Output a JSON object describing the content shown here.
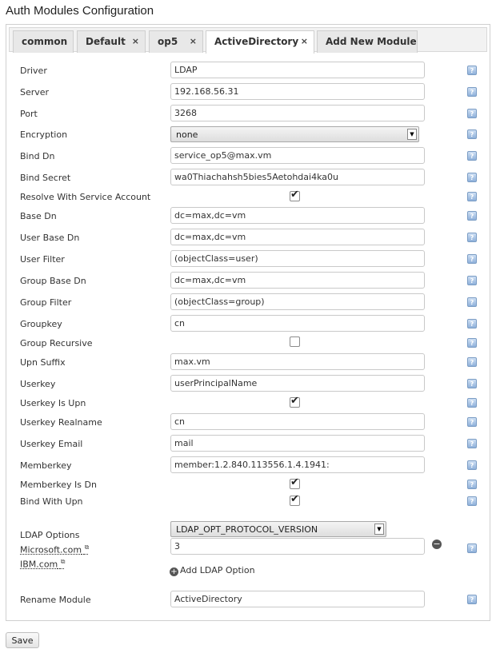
{
  "page": {
    "title": "Auth Modules Configuration"
  },
  "tabs": [
    {
      "label": "common",
      "closable": false,
      "active": false
    },
    {
      "label": "Default",
      "closable": true,
      "active": false
    },
    {
      "label": "op5",
      "closable": true,
      "active": false
    },
    {
      "label": "ActiveDirectory",
      "closable": true,
      "active": true
    },
    {
      "label": "Add New Module",
      "closable": false,
      "active": false
    }
  ],
  "close_glyph": "×",
  "help_glyph": "?",
  "form": {
    "driver": {
      "label": "Driver",
      "value": "LDAP"
    },
    "server": {
      "label": "Server",
      "value": "192.168.56.31"
    },
    "port": {
      "label": "Port",
      "value": "3268"
    },
    "encryption": {
      "label": "Encryption",
      "value": "none"
    },
    "bind_dn": {
      "label": "Bind Dn",
      "value": "service_op5@max.vm"
    },
    "bind_secret": {
      "label": "Bind Secret",
      "value": "wa0Thiachahsh5bies5Aetohdai4ka0u"
    },
    "resolve_with_service_account": {
      "label": "Resolve With Service Account",
      "checked": true
    },
    "base_dn": {
      "label": "Base Dn",
      "value": "dc=max,dc=vm"
    },
    "user_base_dn": {
      "label": "User Base Dn",
      "value": "dc=max,dc=vm"
    },
    "user_filter": {
      "label": "User Filter",
      "value": "(objectClass=user)"
    },
    "group_base_dn": {
      "label": "Group Base Dn",
      "value": "dc=max,dc=vm"
    },
    "group_filter": {
      "label": "Group Filter",
      "value": "(objectClass=group)"
    },
    "groupkey": {
      "label": "Groupkey",
      "value": "cn"
    },
    "group_recursive": {
      "label": "Group Recursive",
      "checked": false
    },
    "upn_suffix": {
      "label": "Upn Suffix",
      "value": "max.vm"
    },
    "userkey": {
      "label": "Userkey",
      "value": "userPrincipalName"
    },
    "userkey_is_upn": {
      "label": "Userkey Is Upn",
      "checked": true
    },
    "userkey_realname": {
      "label": "Userkey Realname",
      "value": "cn"
    },
    "userkey_email": {
      "label": "Userkey Email",
      "value": "mail"
    },
    "memberkey": {
      "label": "Memberkey",
      "value": "member:1.2.840.113556.1.4.1941:"
    },
    "memberkey_is_dn": {
      "label": "Memberkey Is Dn",
      "checked": true
    },
    "bind_with_upn": {
      "label": "Bind With Upn",
      "checked": true
    },
    "ldap_options": {
      "label": "LDAP Options",
      "links": [
        "Microsoft.com",
        "IBM.com"
      ],
      "option_name": "LDAP_OPT_PROTOCOL_VERSION",
      "option_value": "3",
      "remove_glyph": "−",
      "add_label": "Add LDAP Option",
      "add_glyph": "+"
    },
    "rename_module": {
      "label": "Rename Module",
      "value": "ActiveDirectory"
    }
  },
  "save_label": "Save",
  "external_link_glyph": "⧉"
}
